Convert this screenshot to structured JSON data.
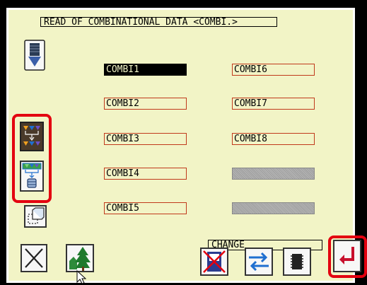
{
  "title": "READ OF COMBINATIONAL DATA <COMBI.>",
  "combinations": {
    "left": [
      {
        "label": "COMBI1",
        "selected": true
      },
      {
        "label": "COMBI2",
        "selected": false
      },
      {
        "label": "COMBI3",
        "selected": false
      },
      {
        "label": "COMBI4",
        "selected": false
      },
      {
        "label": "COMBI5",
        "selected": false
      }
    ],
    "right": [
      {
        "label": "COMBI6",
        "empty": false
      },
      {
        "label": "COMBI7",
        "empty": false
      },
      {
        "label": "COMBI8",
        "empty": false
      },
      {
        "label": "",
        "empty": true
      },
      {
        "label": "",
        "empty": true
      }
    ]
  },
  "change_label": "CHANGE",
  "colors": {
    "panel_bg": "#f2f4c6",
    "highlight_red": "#e3000f",
    "slot_border": "#c0391b",
    "icon_blue": "#1f6fd0",
    "icon_orange": "#f0a020",
    "enter_red": "#c8102e"
  },
  "icons": {
    "sidebar": [
      "needle-down-icon",
      "combination-data-icon",
      "combination-read-icon",
      "copy-layers-icon"
    ],
    "bottom": [
      "cancel-x-icon",
      "forest-image-icon",
      "no-media-icon",
      "swap-arrows-icon",
      "memory-card-icon",
      "enter-return-icon"
    ]
  }
}
